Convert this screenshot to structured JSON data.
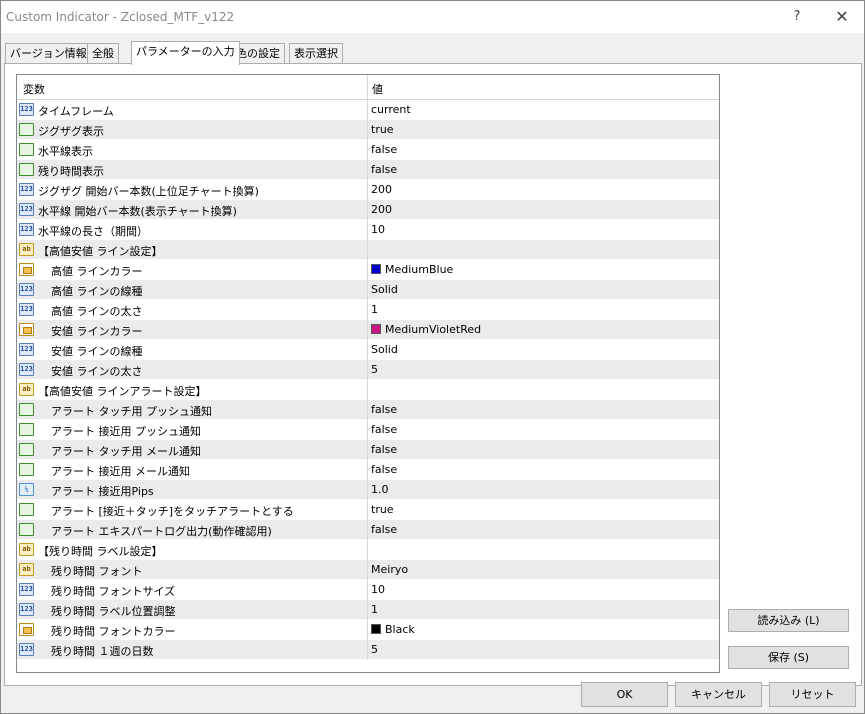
{
  "window": {
    "title": "Custom Indicator - Zclosed_MTF_v122",
    "help_label": "?",
    "close_label": "✕"
  },
  "tabs": [
    {
      "label": "バージョン情報",
      "active": false
    },
    {
      "label": "全般",
      "active": false
    },
    {
      "label": "パラメーターの入力",
      "active": true
    },
    {
      "label": "色の設定",
      "active": false
    },
    {
      "label": "表示選択",
      "active": false
    }
  ],
  "grid": {
    "header_name": "変数",
    "header_value": "値",
    "rows": [
      {
        "type": "int",
        "icon_text": "123",
        "name": "タイムフレーム",
        "value": "current",
        "indent": false
      },
      {
        "type": "bool",
        "icon_text": "",
        "name": "ジグザグ表示",
        "value": "true",
        "indent": false
      },
      {
        "type": "bool",
        "icon_text": "",
        "name": "水平線表示",
        "value": "false",
        "indent": false
      },
      {
        "type": "bool",
        "icon_text": "",
        "name": "残り時間表示",
        "value": "false",
        "indent": false
      },
      {
        "type": "int",
        "icon_text": "123",
        "name": "ジグザグ 開始バー本数(上位足チャート換算)",
        "value": "200",
        "indent": false
      },
      {
        "type": "int",
        "icon_text": "123",
        "name": "水平線 開始バー本数(表示チャート換算)",
        "value": "200",
        "indent": false
      },
      {
        "type": "int",
        "icon_text": "123",
        "name": "水平線の長さ（期間）",
        "value": "10",
        "indent": false
      },
      {
        "type": "str",
        "icon_text": "ab",
        "name": "【高値安値 ライン設定】",
        "value": "",
        "indent": false
      },
      {
        "type": "color",
        "icon_text": "",
        "name": "高値 ラインカラー",
        "value": "MediumBlue",
        "swatch": "#0000cd",
        "indent": true
      },
      {
        "type": "int",
        "icon_text": "123",
        "name": "高値 ラインの線種",
        "value": "Solid",
        "indent": true
      },
      {
        "type": "int",
        "icon_text": "123",
        "name": "高値 ラインの太さ",
        "value": "1",
        "indent": true
      },
      {
        "type": "color",
        "icon_text": "",
        "name": "安値 ラインカラー",
        "value": "MediumVioletRed",
        "swatch": "#c71585",
        "indent": true
      },
      {
        "type": "int",
        "icon_text": "123",
        "name": "安値 ラインの線種",
        "value": "Solid",
        "indent": true
      },
      {
        "type": "int",
        "icon_text": "123",
        "name": "安値 ラインの太さ",
        "value": "5",
        "indent": true
      },
      {
        "type": "str",
        "icon_text": "ab",
        "name": "【高値安値 ラインアラート設定】",
        "value": "",
        "indent": false
      },
      {
        "type": "bool",
        "icon_text": "",
        "name": "アラート タッチ用 プッシュ通知",
        "value": "false",
        "indent": true
      },
      {
        "type": "bool",
        "icon_text": "",
        "name": "アラート 接近用 プッシュ通知",
        "value": "false",
        "indent": true
      },
      {
        "type": "bool",
        "icon_text": "",
        "name": "アラート タッチ用 メール通知",
        "value": "false",
        "indent": true
      },
      {
        "type": "bool",
        "icon_text": "",
        "name": "アラート 接近用 メール通知",
        "value": "false",
        "indent": true
      },
      {
        "type": "dbl",
        "icon_text": "½",
        "name": "アラート 接近用Pips",
        "value": "1.0",
        "indent": true
      },
      {
        "type": "bool",
        "icon_text": "",
        "name": "アラート [接近＋タッチ]をタッチアラートとする",
        "value": "true",
        "indent": true
      },
      {
        "type": "bool",
        "icon_text": "",
        "name": "アラート エキスパートログ出力(動作確認用)",
        "value": "false",
        "indent": true
      },
      {
        "type": "str",
        "icon_text": "ab",
        "name": "【残り時間 ラベル設定】",
        "value": "",
        "indent": false
      },
      {
        "type": "str",
        "icon_text": "ab",
        "name": "残り時間 フォント",
        "value": "Meiryo",
        "indent": true
      },
      {
        "type": "int",
        "icon_text": "123",
        "name": "残り時間 フォントサイズ",
        "value": "10",
        "indent": true
      },
      {
        "type": "int",
        "icon_text": "123",
        "name": "残り時間 ラベル位置調整",
        "value": "1",
        "indent": true
      },
      {
        "type": "color",
        "icon_text": "",
        "name": "残り時間 フォントカラー",
        "value": "Black",
        "swatch": "#000000",
        "indent": true
      },
      {
        "type": "int",
        "icon_text": "123",
        "name": "残り時間 １週の日数",
        "value": "5",
        "indent": true
      }
    ]
  },
  "buttons": {
    "load": "読み込み (L)",
    "save": "保存 (S)",
    "ok": "OK",
    "cancel": "キャンセル",
    "reset": "リセット"
  }
}
